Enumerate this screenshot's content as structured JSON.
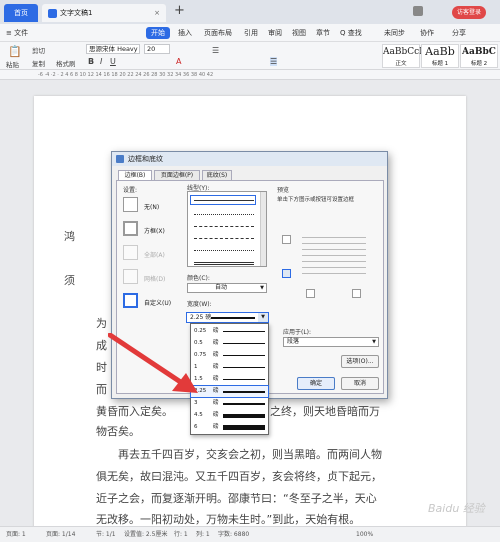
{
  "tabs": {
    "home": "首页",
    "doc": "文字文稿1",
    "doc_close": "×",
    "new": "+",
    "login": "访客登录"
  },
  "menu": {
    "file": "≡ 文件",
    "start": "开始",
    "items": [
      "插入",
      "页面布局",
      "引用",
      "审阅",
      "视图",
      "章节",
      "开发工具",
      "会员专享"
    ],
    "search": "Q 查找",
    "sync": "未同步",
    "collab": "协作",
    "share": "分享"
  },
  "toolbar": {
    "paste": "粘贴",
    "cut": "剪切",
    "copy": "复制",
    "formatbrush": "格式刷",
    "font": "思源宋体 Heavy",
    "size": "20",
    "styles": [
      {
        "sample": "AaBbCcDd",
        "name": "正文"
      },
      {
        "sample": "AaBb",
        "name": "标题 1"
      },
      {
        "sample": "AaBbC",
        "name": "标题 2"
      }
    ]
  },
  "ruler": "-6 ·4 ·2 · 2 4 6 8 10 12 14 16 18 20 22 24 26 28 30 32 34 36 38 40 42",
  "document": {
    "lines": [
      "鸿",
      "须",
      "为",
      "成",
      "时",
      "而",
      "黄昏而入定矣。",
      "之终，则天地昏暗而万",
      "物否矣。",
      "再去五千四百岁，交亥会之初，则当黑暗。而两间人物",
      "俱无矣，故曰混沌。又五千四百岁，亥会将终，贞下起元，",
      "近子之会，而复逐渐开明。邵康节曰：“冬至子之半，天心",
      "无改移。一阳初动处，万物未生时。”到此，天始有根。"
    ]
  },
  "dialog": {
    "title": "边框和底纹",
    "tabs": [
      "边框(B)",
      "页面边框(P)",
      "底纹(S)"
    ],
    "setting_label": "设置:",
    "settings": [
      "无(N)",
      "方框(X)",
      "全部(A)",
      "网格(D)",
      "自定义(U)"
    ],
    "style_label": "线型(Y):",
    "color_label": "颜色(C):",
    "color_value": "自动",
    "width_label": "宽度(W):",
    "width_value": "2.25 磅",
    "preview_label": "预览",
    "preview_hint": "单击下方图示或按钮可设置边框",
    "apply_label": "应用于(L):",
    "apply_value": "段落",
    "options": "选项(O)...",
    "ok": "确定",
    "cancel": "取消"
  },
  "widths": [
    {
      "v": "0.25",
      "u": "磅",
      "w": 0.25
    },
    {
      "v": "0.5",
      "u": "磅",
      "w": 0.5
    },
    {
      "v": "0.75",
      "u": "磅",
      "w": 0.75
    },
    {
      "v": "1",
      "u": "磅",
      "w": 1
    },
    {
      "v": "1.5",
      "u": "磅",
      "w": 1.5
    },
    {
      "v": "2.25",
      "u": "磅",
      "w": 2.25
    },
    {
      "v": "3",
      "u": "磅",
      "w": 3
    },
    {
      "v": "4.5",
      "u": "磅",
      "w": 4.5
    },
    {
      "v": "6",
      "u": "磅",
      "w": 6
    }
  ],
  "status": {
    "page": "页面: 1",
    "pages": "页面: 1/14",
    "section": "节: 1/1",
    "setting": "设置值: 2.5厘米",
    "row": "行: 1",
    "col": "列: 1",
    "words": "字数: 6880",
    "zoom": "100%"
  },
  "watermark": "Baidu 经验",
  "colors": {
    "accent": "#2d6be4",
    "arrow": "#e23a3a"
  }
}
